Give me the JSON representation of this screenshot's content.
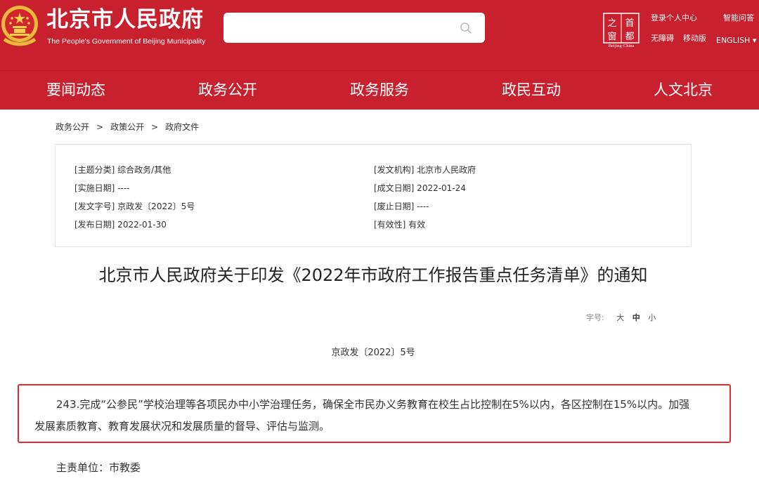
{
  "header": {
    "site_title": "北京市人民政府",
    "site_subtitle": "The People's Government of Beijing Municipality",
    "search_placeholder": "",
    "capital_logo_top": "首都",
    "capital_logo_bottom": "之窗",
    "capital_logo_caption": "Beijing·China",
    "login_link": "登录个人中心",
    "qa_link": "智能问答",
    "accessibility_link": "无障碍",
    "mobile_link": "移动版",
    "english_link": "ENGLISH ▾"
  },
  "nav": {
    "items": [
      "要闻动态",
      "政务公开",
      "政务服务",
      "政民互动",
      "人文北京"
    ]
  },
  "breadcrumb": {
    "items": [
      "政务公开",
      "政策公开",
      "政府文件"
    ],
    "separator": ">"
  },
  "meta": {
    "topic": "[主题分类] 综合政务/其他",
    "issuer": "[发文机构] 北京市人民政府",
    "effective_date": "[实施日期] ----",
    "written_date": "[成文日期] 2022-01-24",
    "doc_number": "[发文字号] 京政发〔2022〕5号",
    "expiry_date": "[废止日期] ----",
    "publish_date": "[发布日期] 2022-01-30",
    "validity": "[有效性] 有效"
  },
  "document": {
    "title": "北京市人民政府关于印发《2022年市政府工作报告重点任务清单》的通知",
    "font_size_label": "字号:",
    "font_large": "大",
    "font_medium": "中",
    "font_small": "小",
    "number": "京政发〔2022〕5号",
    "highlight_line1": "243.完成“公参民”学校治理等各项民办中小学治理任务，确保全市民办义务教育在校生占比控制在5%以内，各区控制在15%以内。加强",
    "highlight_line2": "发展素质教育、教育发展状况和发展质量的督导、评估与监测。",
    "responsible_unit": "主责单位：市教委"
  },
  "colors": {
    "brand_red": "#c8202d",
    "highlight_border": "#e32b2b"
  }
}
